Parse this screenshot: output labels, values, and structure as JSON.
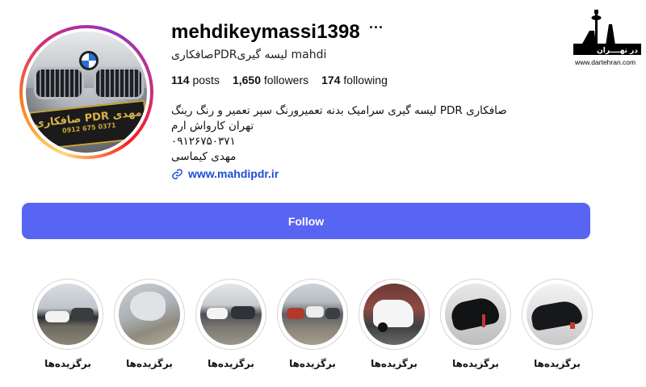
{
  "profile": {
    "username": "mehdikeymassi1398",
    "more_icon": "ellipsis-icon",
    "full_name": "صافکاریPDRلیسه گیری mahdi",
    "avatar_plate_line1": "صافکاری PDR مهدی",
    "avatar_plate_line2": "0912 675 0371",
    "stats": {
      "posts_count": "114",
      "posts_label": "posts",
      "followers_count": "1,650",
      "followers_label": "followers",
      "following_count": "174",
      "following_label": "following"
    },
    "bio_lines": [
      "صافکاری PDR لیسه گیری سرامیک بدنه تعمیرورنگ سپر تعمیر و رنگ رینگ",
      "تهران کارواش ارم",
      "۰۹۱۲۶۷۵۰۳۷۱",
      "مهدی کیماسی"
    ],
    "link_icon": "link-icon",
    "website": "www.mahdipdr.ir"
  },
  "watermark": {
    "site": "www.dartehran.com",
    "title": "در تهــــران"
  },
  "follow_button": {
    "label": "Follow",
    "color": "#5865f2"
  },
  "highlights": [
    {
      "label": "برگزیده‌ها"
    },
    {
      "label": "برگزیده‌ها"
    },
    {
      "label": "برگزیده‌ها"
    },
    {
      "label": "برگزیده‌ها"
    },
    {
      "label": "برگزیده‌ها"
    },
    {
      "label": "برگزیده‌ها"
    },
    {
      "label": "برگزیده‌ها"
    }
  ]
}
